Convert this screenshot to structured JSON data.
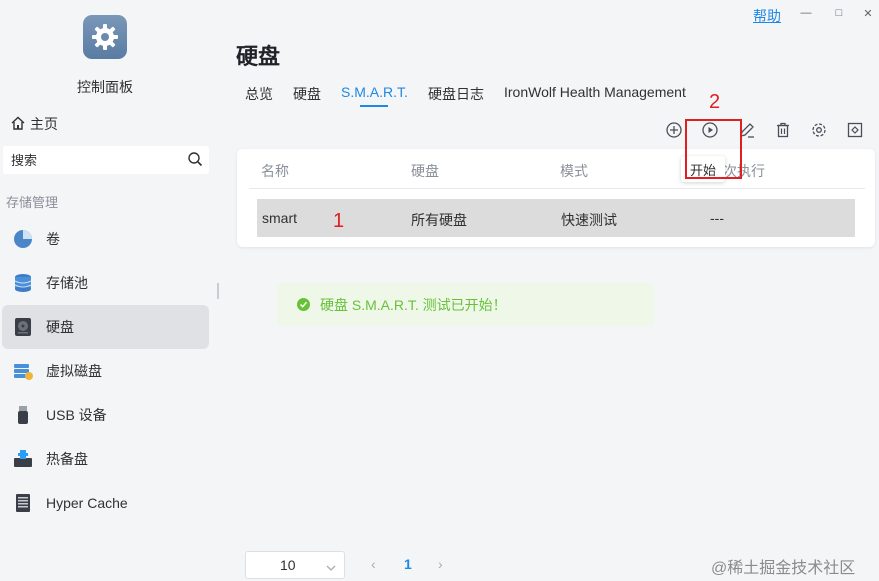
{
  "app": {
    "title": "控制面板",
    "home_label": "主页",
    "search_placeholder": "搜索",
    "section_label": "存储管理"
  },
  "sidebar": {
    "items": [
      {
        "label": "卷",
        "icon": "pie-volume-icon"
      },
      {
        "label": "存储池",
        "icon": "storage-pool-icon"
      },
      {
        "label": "硬盘",
        "icon": "hard-disk-icon",
        "active": true
      },
      {
        "label": "虚拟磁盘",
        "icon": "virtual-disk-icon"
      },
      {
        "label": "USB 设备",
        "icon": "usb-icon"
      },
      {
        "label": "热备盘",
        "icon": "hot-spare-icon"
      },
      {
        "label": "Hyper Cache",
        "icon": "hyper-cache-icon"
      }
    ]
  },
  "window": {
    "help_label": "帮助",
    "minimize": "—",
    "maximize": "□",
    "close": "✕"
  },
  "page": {
    "title": "硬盘",
    "tabs": [
      "总览",
      "硬盘",
      "S.M.A.R.T.",
      "硬盘日志",
      "IronWolf Health Management"
    ],
    "active_tab": "S.M.A.R.T."
  },
  "toolbar": {
    "buttons": [
      "add-icon",
      "play-icon",
      "edit-icon",
      "delete-icon",
      "settings-icon",
      "expand-icon"
    ]
  },
  "table": {
    "headers": [
      "名称",
      "硬盘",
      "模式",
      "上次执行"
    ],
    "header_visible_tail": "次执行",
    "rows": [
      {
        "name": "smart",
        "disk": "所有硬盘",
        "mode": "快速测试",
        "last_run": "---"
      }
    ]
  },
  "tooltip": {
    "text": "开始"
  },
  "annotations": {
    "label_1": "1",
    "label_2": "2",
    "color": "#e02020"
  },
  "toast": {
    "message": "硬盘 S.M.A.R.T. 测试已开始！",
    "color": "#67c23a"
  },
  "pagination": {
    "page_size": "10",
    "current_page": "1",
    "prev": "‹",
    "next": "›"
  },
  "watermark": "@稀土掘金技术社区",
  "colors": {
    "accent": "#1e88e5",
    "success": "#67c23a",
    "annotation": "#e02020"
  }
}
